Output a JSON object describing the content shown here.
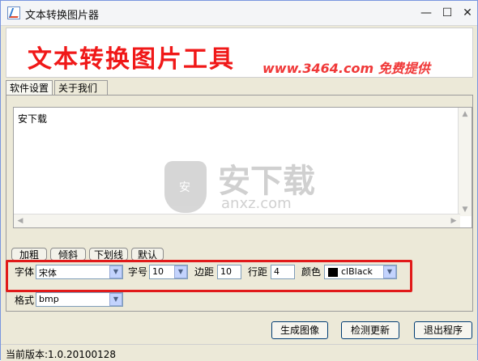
{
  "window": {
    "title": "文本转换图片器",
    "min_glyph": "—",
    "max_glyph": "☐",
    "close_glyph": "✕"
  },
  "banner": {
    "title": "文本转换图片工具",
    "subtitle": "www.3464.com 免费提供"
  },
  "tabs": [
    {
      "label": "软件设置"
    },
    {
      "label": "关于我们"
    }
  ],
  "editor": {
    "content": "安下载",
    "watermark_main": "安下载",
    "watermark_sub": "anxz.com",
    "watermark_badge": "安"
  },
  "format_buttons": [
    "加粗",
    "倾斜",
    "下划线",
    "默认"
  ],
  "settings": {
    "font_label": "字体",
    "font_value": "宋体",
    "size_label": "字号",
    "size_value": "10",
    "margin_label": "边距",
    "margin_value": "10",
    "line_label": "行距",
    "line_value": "4",
    "color_label": "颜色",
    "color_value": "clBlack",
    "format_label": "格式",
    "format_value": "bmp"
  },
  "actions": {
    "generate": "生成图像",
    "update": "检测更新",
    "exit": "退出程序"
  },
  "status": {
    "version": "当前版本:1.0.20100128"
  },
  "colors": {
    "banner_red": "#f01818",
    "highlight_red": "#e11a1a",
    "selected_color": "#000000"
  }
}
